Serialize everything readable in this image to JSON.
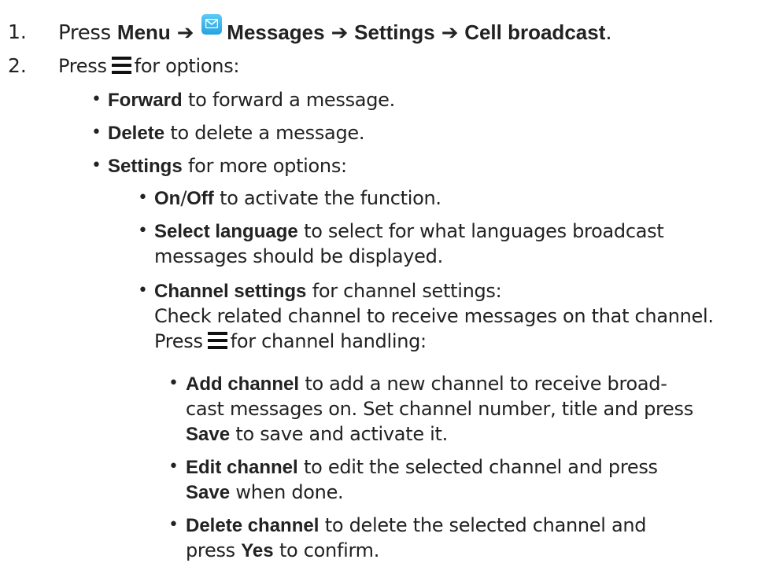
{
  "step1": {
    "number": "1.",
    "press": "Press",
    "menu": "Menu",
    "arrow": "➔",
    "messages": "Messages",
    "settings": "Settings",
    "cell_broadcast": "Cell broadcast",
    "period": "."
  },
  "step2": {
    "number": "2.",
    "press": "Press",
    "for_options": "for options:"
  },
  "bullet_char": "•",
  "options": {
    "forward": {
      "label": "Forward",
      "text": "to forward a message."
    },
    "delete": {
      "label": "Delete",
      "text": "to delete a message."
    },
    "settings": {
      "label": "Settings",
      "text": "for more options:"
    }
  },
  "settings_options": {
    "on": "On",
    "slash": "/",
    "off": "Off",
    "on_off_text": "to activate the function.",
    "select_language": "Select language",
    "select_language_text1": "to select for what languages broadcast",
    "select_language_text2": "messages should be displayed.",
    "channel_settings": "Channel settings",
    "channel_settings_text": "for channel settings:",
    "check_related": "Check related channel to receive messages on that channel.",
    "press": "Press",
    "channel_handling": "for channel handling:"
  },
  "channel_options": {
    "add_channel": "Add channel",
    "add_text1": "to add a new channel to receive broad-",
    "add_text2": "cast messages on. Set channel number, title and press",
    "save": "Save",
    "add_text3": "to save and activate it.",
    "edit_channel": "Edit channel",
    "edit_text1": "to edit the selected channel and press",
    "edit_text2": "when done.",
    "delete_channel": "Delete channel",
    "delete_text1": "to delete the selected channel and",
    "delete_text2a": "press",
    "yes": "Yes",
    "delete_text2b": "to confirm."
  },
  "icons": [
    "message-icon",
    "menu-icon"
  ],
  "colors": {
    "text": "#222222",
    "icon_blue": "#26a3e0"
  }
}
